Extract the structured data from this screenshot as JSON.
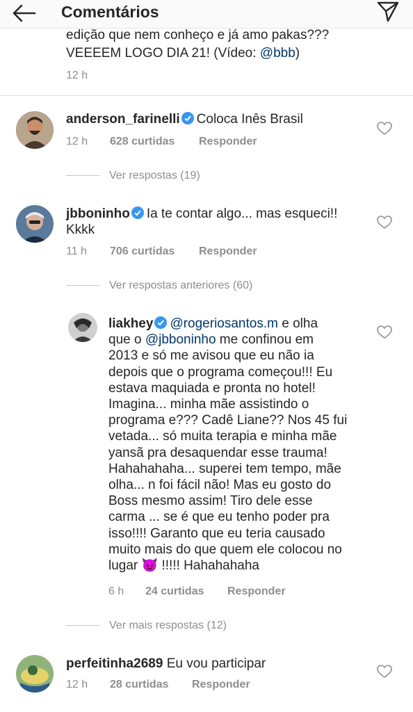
{
  "header": {
    "title": "Comentários",
    "back_icon": "arrow-left-icon",
    "share_icon": "paper-plane-icon"
  },
  "caption": {
    "text_line1": "edição que nem conheço e já amo pakas???",
    "text_line2_prefix": "VEEEEM LOGO DIA 21! (Vídeo: ",
    "text_line2_mention": "@bbb",
    "text_line2_suffix": ")",
    "time": "12 h"
  },
  "comments": [
    {
      "username": "anderson_farinelli",
      "text": "Coloca Inês Brasil",
      "time": "12 h",
      "likes": "628 curtidas",
      "reply": "Responder",
      "replies_link": "Ver respostas (19)"
    },
    {
      "username": "jbboninho",
      "text": "Ia te contar algo... mas esqueci!!",
      "text2": "Kkkk",
      "time": "11 h",
      "likes": "706 curtidas",
      "reply": "Responder",
      "replies_link": "Ver respostas anteriores (60)"
    },
    {
      "username": "liakhey",
      "mention1": "@rogeriosantos.m",
      "text_a": " e olha",
      "text_b": "que o ",
      "mention2": "@jbboninho",
      "text_c": " me confinou em",
      "lines": [
        "2013 e só me avisou que eu não ia",
        "depois que o programa começou!!! Eu",
        "estava maquiada e pronta no hotel!",
        "Imagina... minha mãe assistindo o",
        "programa e??? Cadê Liane?? Nos 45 fui",
        "vetada... só muita terapia e minha mãe",
        "yansã pra desaquendar esse trauma!",
        "Hahahahaha... superei tem tempo, mãe",
        "olha... n foi fácil não! Mas eu gosto do",
        "Boss mesmo assim! Tiro dele esse",
        "carma ... se é que eu tenho poder pra",
        "isso!!!! Garanto que eu teria causado",
        "muito mais do que quem ele colocou no"
      ],
      "last_line_a": "lugar ",
      "emoji": "😈",
      "last_line_b": " !!!!! Hahahahaha",
      "time": "6 h",
      "likes": "24 curtidas",
      "reply": "Responder",
      "replies_link": "Ver mais respostas (12)"
    },
    {
      "username": "perfeitinha2689",
      "text": "Eu vou participar",
      "time": "12 h",
      "likes": "28 curtidas",
      "reply": "Responder"
    }
  ],
  "colors": {
    "verified": "#3897f0",
    "mention": "#00376b",
    "muted": "#8e8e8e",
    "emoji_purple": "#8e44ad"
  }
}
